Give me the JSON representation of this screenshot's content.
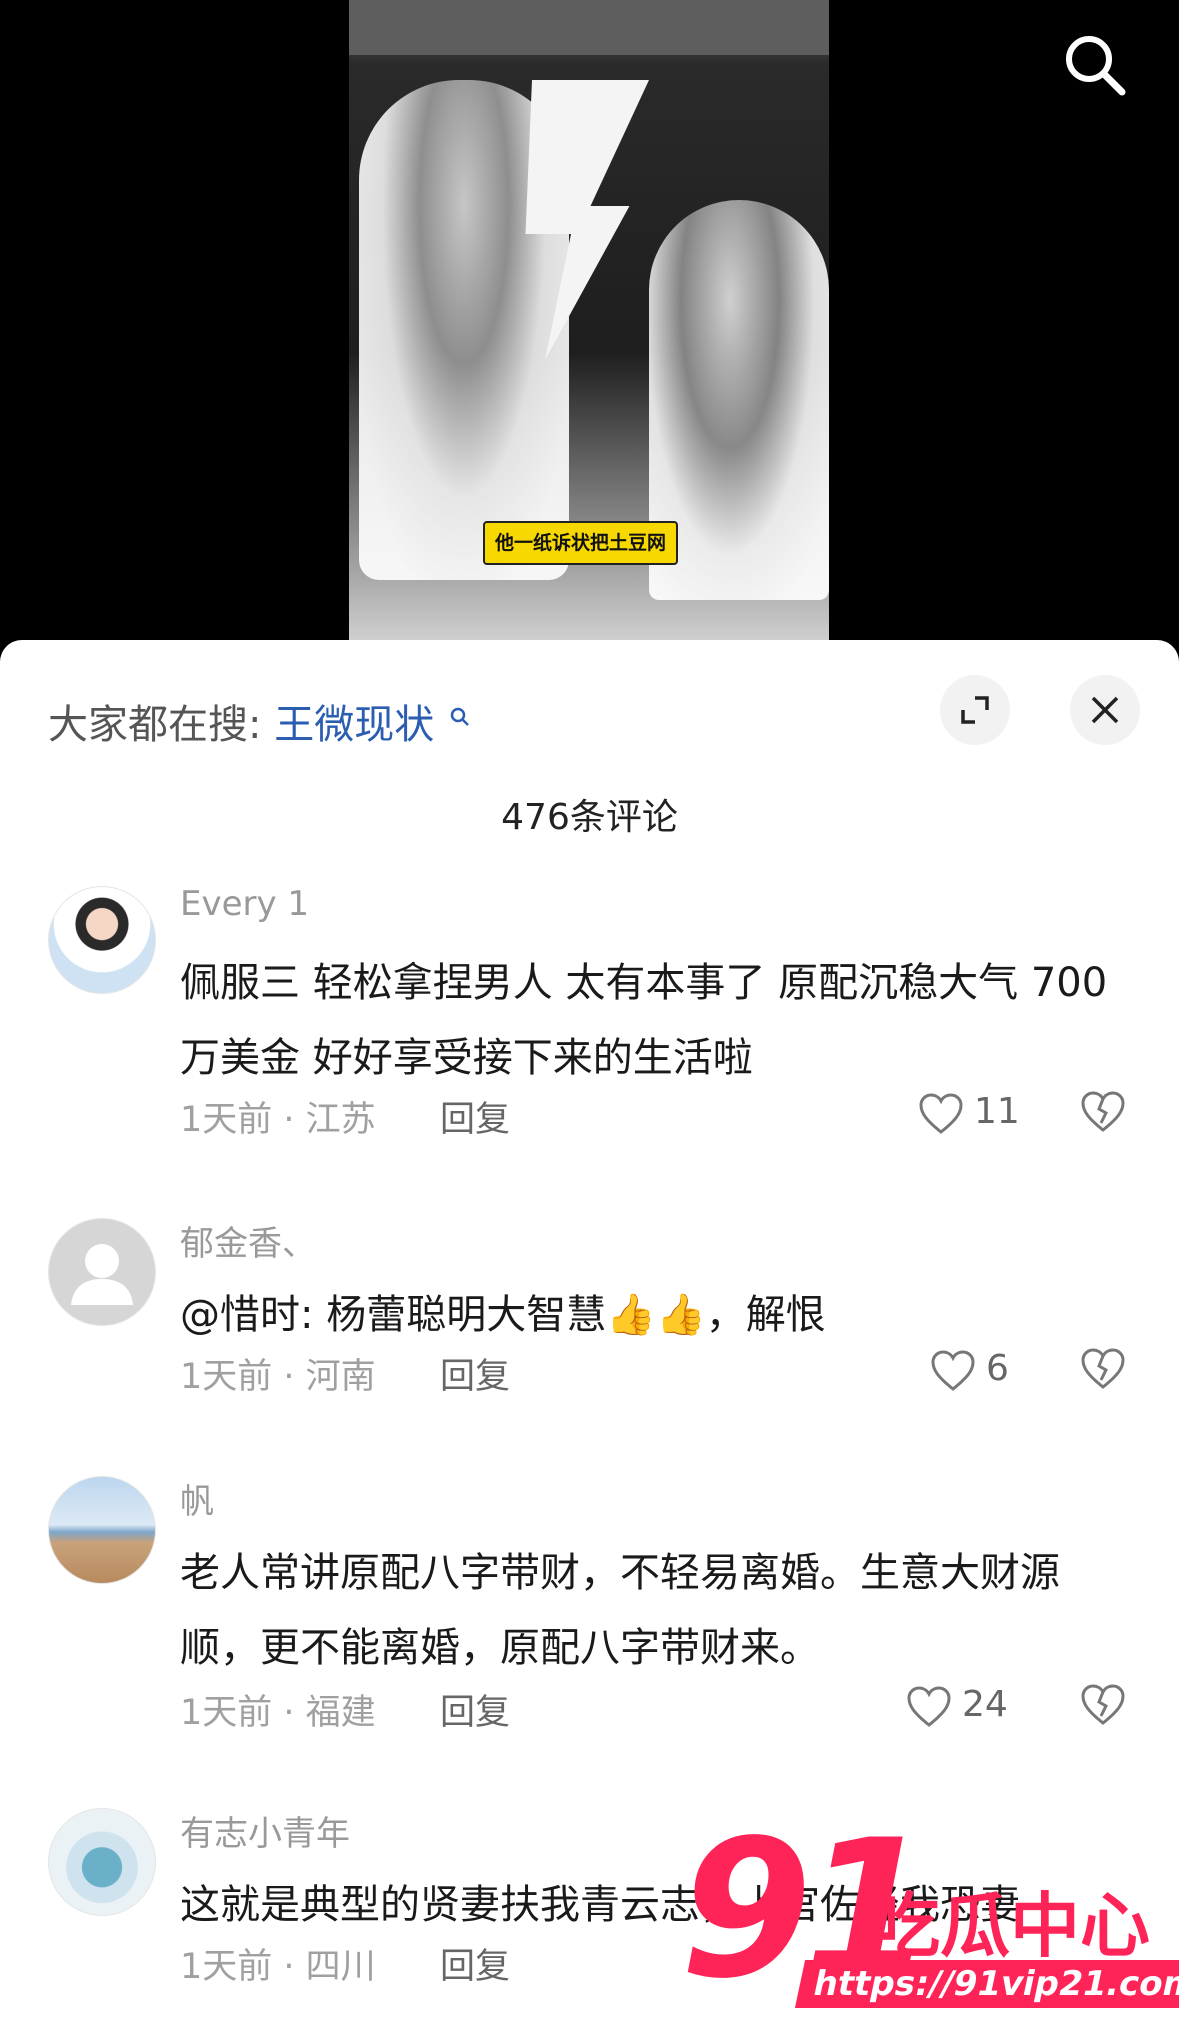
{
  "video": {
    "caption": "他一纸诉状把土豆网"
  },
  "top_right": {
    "icon": "search-icon"
  },
  "sheet": {
    "suggest_prefix": "大家都在搜:",
    "suggest_keyword": "王微现状",
    "comment_count": "476条评论",
    "expand_icon": "expand-icon",
    "close_icon": "close-icon"
  },
  "comments": [
    {
      "username": "Every 1",
      "text": "佩服三 轻松拿捏男人 太有本事了 原配沉稳大气 700万美金 好好享受接下来的生活啦",
      "meta": "1天前 · 江苏",
      "reply": "回复",
      "likes": "11"
    },
    {
      "username": "郁金香、",
      "text": "@惜时: 杨蕾聪明大智慧👍👍，解恨",
      "meta": "1天前 · 河南",
      "reply": "回复",
      "likes": "6"
    },
    {
      "username": "帆",
      "text": "老人常讲原配八字带财，不轻易离婚。生意大财源顺，更不能离婚，原配八字带财来。",
      "meta": "1天前 · 福建",
      "reply": "回复",
      "likes": "24"
    },
    {
      "username": "有志小青年",
      "text": "这就是典型的贤妻扶我青云志，上官佐轻我恐妻",
      "meta": "1天前 · 四川",
      "reply": "回复",
      "likes": ""
    }
  ],
  "watermark": {
    "big": "91",
    "cn": "吃瓜中心",
    "url": "https://91vip21.com"
  },
  "colors": {
    "accent_link": "#2b5eb1",
    "watermark": "#ff2458",
    "caption_bg": "#f7d800"
  }
}
